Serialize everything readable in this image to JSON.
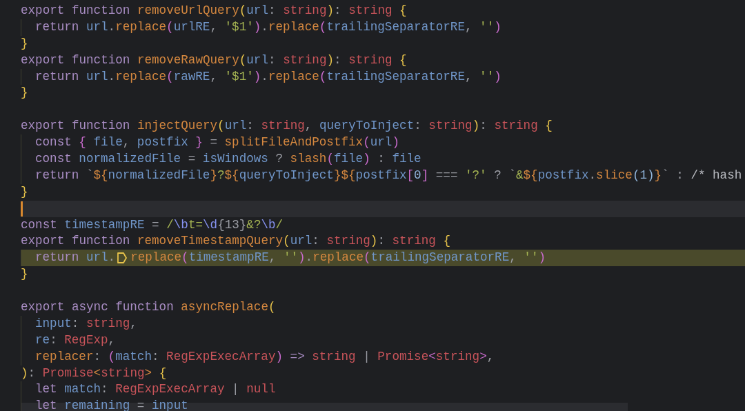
{
  "editor": {
    "lines": [
      {
        "indented": false,
        "current": false,
        "highlighted": false,
        "tokens": [
          {
            "text": "export function ",
            "kind": "kw"
          },
          {
            "text": "removeUrlQuery",
            "kind": "fn"
          },
          {
            "text": "(",
            "kind": "y"
          },
          {
            "text": "url",
            "kind": "id"
          },
          {
            "text": ": ",
            "kind": "op"
          },
          {
            "text": "string",
            "kind": "type"
          },
          {
            "text": ")",
            "kind": "y"
          },
          {
            "text": ": ",
            "kind": "op"
          },
          {
            "text": "string ",
            "kind": "type"
          },
          {
            "text": "{",
            "kind": "y"
          }
        ]
      },
      {
        "indented": true,
        "current": false,
        "highlighted": false,
        "tokens": [
          {
            "text": "return ",
            "kind": "kw"
          },
          {
            "text": "url",
            "kind": "id"
          },
          {
            "text": ".",
            "kind": "op"
          },
          {
            "text": "replace",
            "kind": "fn"
          },
          {
            "text": "(",
            "kind": "p"
          },
          {
            "text": "urlRE",
            "kind": "id"
          },
          {
            "text": ", ",
            "kind": "op"
          },
          {
            "text": "'$1'",
            "kind": "str"
          },
          {
            "text": ")",
            "kind": "p"
          },
          {
            "text": ".",
            "kind": "op"
          },
          {
            "text": "replace",
            "kind": "fn"
          },
          {
            "text": "(",
            "kind": "p"
          },
          {
            "text": "trailingSeparatorRE",
            "kind": "id"
          },
          {
            "text": ", ",
            "kind": "op"
          },
          {
            "text": "''",
            "kind": "str"
          },
          {
            "text": ")",
            "kind": "p"
          }
        ]
      },
      {
        "indented": false,
        "current": false,
        "highlighted": false,
        "tokens": [
          {
            "text": "}",
            "kind": "y"
          }
        ]
      },
      {
        "indented": false,
        "current": false,
        "highlighted": false,
        "tokens": [
          {
            "text": "export function ",
            "kind": "kw"
          },
          {
            "text": "removeRawQuery",
            "kind": "fn"
          },
          {
            "text": "(",
            "kind": "y"
          },
          {
            "text": "url",
            "kind": "id"
          },
          {
            "text": ": ",
            "kind": "op"
          },
          {
            "text": "string",
            "kind": "type"
          },
          {
            "text": ")",
            "kind": "y"
          },
          {
            "text": ": ",
            "kind": "op"
          },
          {
            "text": "string ",
            "kind": "type"
          },
          {
            "text": "{",
            "kind": "y"
          }
        ]
      },
      {
        "indented": true,
        "current": false,
        "highlighted": false,
        "tokens": [
          {
            "text": "return ",
            "kind": "kw"
          },
          {
            "text": "url",
            "kind": "id"
          },
          {
            "text": ".",
            "kind": "op"
          },
          {
            "text": "replace",
            "kind": "fn"
          },
          {
            "text": "(",
            "kind": "p"
          },
          {
            "text": "rawRE",
            "kind": "id"
          },
          {
            "text": ", ",
            "kind": "op"
          },
          {
            "text": "'$1'",
            "kind": "str"
          },
          {
            "text": ")",
            "kind": "p"
          },
          {
            "text": ".",
            "kind": "op"
          },
          {
            "text": "replace",
            "kind": "fn"
          },
          {
            "text": "(",
            "kind": "p"
          },
          {
            "text": "trailingSeparatorRE",
            "kind": "id"
          },
          {
            "text": ", ",
            "kind": "op"
          },
          {
            "text": "''",
            "kind": "str"
          },
          {
            "text": ")",
            "kind": "p"
          }
        ]
      },
      {
        "indented": false,
        "current": false,
        "highlighted": false,
        "tokens": [
          {
            "text": "}",
            "kind": "y"
          }
        ]
      },
      {
        "indented": false,
        "current": false,
        "highlighted": false
      },
      {
        "indented": false,
        "current": false,
        "highlighted": false,
        "tokens": [
          {
            "text": "export function ",
            "kind": "kw"
          },
          {
            "text": "injectQuery",
            "kind": "fn"
          },
          {
            "text": "(",
            "kind": "y"
          },
          {
            "text": "url",
            "kind": "id"
          },
          {
            "text": ": ",
            "kind": "op"
          },
          {
            "text": "string",
            "kind": "type"
          },
          {
            "text": ", ",
            "kind": "op"
          },
          {
            "text": "queryToInject",
            "kind": "id"
          },
          {
            "text": ": ",
            "kind": "op"
          },
          {
            "text": "string",
            "kind": "type"
          },
          {
            "text": ")",
            "kind": "y"
          },
          {
            "text": ": ",
            "kind": "op"
          },
          {
            "text": "string ",
            "kind": "type"
          },
          {
            "text": "{",
            "kind": "y"
          }
        ]
      },
      {
        "indented": true,
        "current": false,
        "highlighted": false,
        "tokens": [
          {
            "text": "const ",
            "kind": "kw"
          },
          {
            "text": "{ ",
            "kind": "p"
          },
          {
            "text": "file",
            "kind": "id"
          },
          {
            "text": ", ",
            "kind": "op"
          },
          {
            "text": "postfix ",
            "kind": "id"
          },
          {
            "text": "}",
            "kind": "p"
          },
          {
            "text": " = ",
            "kind": "op"
          },
          {
            "text": "splitFileAndPostfix",
            "kind": "fn"
          },
          {
            "text": "(",
            "kind": "p"
          },
          {
            "text": "url",
            "kind": "id"
          },
          {
            "text": ")",
            "kind": "p"
          }
        ]
      },
      {
        "indented": true,
        "current": false,
        "highlighted": false,
        "tokens": [
          {
            "text": "const ",
            "kind": "kw"
          },
          {
            "text": "normalizedFile",
            "kind": "id"
          },
          {
            "text": " = ",
            "kind": "op"
          },
          {
            "text": "isWindows",
            "kind": "id"
          },
          {
            "text": " ? ",
            "kind": "op"
          },
          {
            "text": "slash",
            "kind": "fn"
          },
          {
            "text": "(",
            "kind": "p"
          },
          {
            "text": "file",
            "kind": "id"
          },
          {
            "text": ")",
            "kind": "p"
          },
          {
            "text": " : ",
            "kind": "op"
          },
          {
            "text": "file",
            "kind": "id"
          }
        ]
      },
      {
        "indented": true,
        "current": false,
        "highlighted": false,
        "tokens": [
          {
            "text": "return ",
            "kind": "kw"
          },
          {
            "text": "`",
            "kind": "op"
          },
          {
            "text": "${",
            "kind": "tpl"
          },
          {
            "text": "normalizedFile",
            "kind": "id"
          },
          {
            "text": "}",
            "kind": "tpl"
          },
          {
            "text": "?",
            "kind": "str"
          },
          {
            "text": "${",
            "kind": "tpl"
          },
          {
            "text": "queryToInject",
            "kind": "id"
          },
          {
            "text": "}${",
            "kind": "tpl"
          },
          {
            "text": "postfix",
            "kind": "id"
          },
          {
            "text": "[",
            "kind": "p"
          },
          {
            "text": "0",
            "kind": "num"
          },
          {
            "text": "]",
            "kind": "p"
          },
          {
            "text": " === ",
            "kind": "op"
          },
          {
            "text": "'?'",
            "kind": "str"
          },
          {
            "text": " ? ",
            "kind": "op"
          },
          {
            "text": "`",
            "kind": "op"
          },
          {
            "text": "&",
            "kind": "str"
          },
          {
            "text": "${",
            "kind": "tpl"
          },
          {
            "text": "postfix",
            "kind": "id"
          },
          {
            "text": ".",
            "kind": "op"
          },
          {
            "text": "slice",
            "kind": "fn"
          },
          {
            "text": "(",
            "kind": "b"
          },
          {
            "text": "1",
            "kind": "num"
          },
          {
            "text": ")",
            "kind": "b"
          },
          {
            "text": "}",
            "kind": "tpl"
          },
          {
            "text": "` : ",
            "kind": "op"
          },
          {
            "text": "/* hash",
            "kind": "cm"
          }
        ]
      },
      {
        "indented": false,
        "current": false,
        "highlighted": false,
        "tokens": [
          {
            "text": "}",
            "kind": "y"
          }
        ]
      },
      {
        "indented": false,
        "current": true,
        "highlighted": false
      },
      {
        "indented": false,
        "current": false,
        "highlighted": false,
        "tokens": [
          {
            "text": "const ",
            "kind": "kw"
          },
          {
            "text": "timestampRE",
            "kind": "id"
          },
          {
            "text": " = ",
            "kind": "op"
          },
          {
            "text": "/",
            "kind": "str"
          },
          {
            "text": "\\b",
            "kind": "esc"
          },
          {
            "text": "t=",
            "kind": "str"
          },
          {
            "text": "\\d",
            "kind": "esc"
          },
          {
            "text": "{13}",
            "kind": "op"
          },
          {
            "text": "&?",
            "kind": "str"
          },
          {
            "text": "\\b",
            "kind": "esc"
          },
          {
            "text": "/",
            "kind": "str"
          }
        ]
      },
      {
        "indented": false,
        "current": false,
        "highlighted": false,
        "tokens": [
          {
            "text": "export function ",
            "kind": "kw"
          },
          {
            "text": "removeTimestampQuery",
            "kind": "fn"
          },
          {
            "text": "(",
            "kind": "y"
          },
          {
            "text": "url",
            "kind": "id"
          },
          {
            "text": ": ",
            "kind": "op"
          },
          {
            "text": "string",
            "kind": "type"
          },
          {
            "text": ")",
            "kind": "y"
          },
          {
            "text": ": ",
            "kind": "op"
          },
          {
            "text": "string ",
            "kind": "type"
          },
          {
            "text": "{",
            "kind": "y"
          }
        ]
      },
      {
        "indented": true,
        "current": false,
        "highlighted": true,
        "tokens": [
          {
            "text": "return ",
            "kind": "kw"
          },
          {
            "text": "url",
            "kind": "id"
          },
          {
            "text": ".",
            "kind": "op"
          },
          {
            "kind": "hint"
          },
          {
            "text": "replace",
            "kind": "fn"
          },
          {
            "text": "(",
            "kind": "p"
          },
          {
            "text": "timestampRE",
            "kind": "id"
          },
          {
            "text": ", ",
            "kind": "op"
          },
          {
            "text": "''",
            "kind": "str"
          },
          {
            "text": ")",
            "kind": "p"
          },
          {
            "text": ".",
            "kind": "op"
          },
          {
            "text": "replace",
            "kind": "fn"
          },
          {
            "text": "(",
            "kind": "p"
          },
          {
            "text": "trailingSeparatorRE",
            "kind": "id"
          },
          {
            "text": ", ",
            "kind": "op"
          },
          {
            "text": "''",
            "kind": "str"
          },
          {
            "text": ")",
            "kind": "p"
          }
        ]
      },
      {
        "indented": false,
        "current": false,
        "highlighted": false,
        "tokens": [
          {
            "text": "}",
            "kind": "y"
          }
        ]
      },
      {
        "indented": false,
        "current": false,
        "highlighted": false
      },
      {
        "indented": false,
        "current": false,
        "highlighted": false,
        "tokens": [
          {
            "text": "export async function ",
            "kind": "kw"
          },
          {
            "text": "asyncReplace",
            "kind": "fn"
          },
          {
            "text": "(",
            "kind": "y"
          }
        ]
      },
      {
        "indented": true,
        "current": false,
        "highlighted": false,
        "tokens": [
          {
            "text": "input",
            "kind": "id"
          },
          {
            "text": ": ",
            "kind": "op"
          },
          {
            "text": "string",
            "kind": "type"
          },
          {
            "text": ",",
            "kind": "op"
          }
        ]
      },
      {
        "indented": true,
        "current": false,
        "highlighted": false,
        "tokens": [
          {
            "text": "re",
            "kind": "id"
          },
          {
            "text": ": ",
            "kind": "op"
          },
          {
            "text": "RegExp",
            "kind": "type"
          },
          {
            "text": ",",
            "kind": "op"
          }
        ]
      },
      {
        "indented": true,
        "current": false,
        "highlighted": false,
        "tokens": [
          {
            "text": "replacer",
            "kind": "fn"
          },
          {
            "text": ": ",
            "kind": "op"
          },
          {
            "text": "(",
            "kind": "p"
          },
          {
            "text": "match",
            "kind": "id"
          },
          {
            "text": ": ",
            "kind": "op"
          },
          {
            "text": "RegExpExecArray",
            "kind": "type"
          },
          {
            "text": ")",
            "kind": "p"
          },
          {
            "text": " => ",
            "kind": "kw"
          },
          {
            "text": "string",
            "kind": "type"
          },
          {
            "text": " | ",
            "kind": "op"
          },
          {
            "text": "Promise",
            "kind": "type"
          },
          {
            "text": "<",
            "kind": "p"
          },
          {
            "text": "string",
            "kind": "type"
          },
          {
            "text": ">",
            "kind": "p"
          },
          {
            "text": ",",
            "kind": "op"
          }
        ]
      },
      {
        "indented": false,
        "current": false,
        "highlighted": false,
        "tokens": [
          {
            "text": ")",
            "kind": "y"
          },
          {
            "text": ": ",
            "kind": "op"
          },
          {
            "text": "Promise",
            "kind": "type"
          },
          {
            "text": "<",
            "kind": "fn"
          },
          {
            "text": "string",
            "kind": "type"
          },
          {
            "text": "> ",
            "kind": "fn"
          },
          {
            "text": "{",
            "kind": "y"
          }
        ]
      },
      {
        "indented": true,
        "current": false,
        "highlighted": false,
        "tokens": [
          {
            "text": "let ",
            "kind": "kw"
          },
          {
            "text": "match",
            "kind": "id"
          },
          {
            "text": ": ",
            "kind": "op"
          },
          {
            "text": "RegExpExecArray",
            "kind": "type"
          },
          {
            "text": " | ",
            "kind": "op"
          },
          {
            "text": "null",
            "kind": "type"
          }
        ]
      },
      {
        "indented": true,
        "current": false,
        "highlighted": false,
        "tokens": [
          {
            "text": "let ",
            "kind": "kw"
          },
          {
            "text": "remaining",
            "kind": "id"
          },
          {
            "text": " = ",
            "kind": "op"
          },
          {
            "text": "input",
            "kind": "id"
          }
        ]
      }
    ]
  }
}
